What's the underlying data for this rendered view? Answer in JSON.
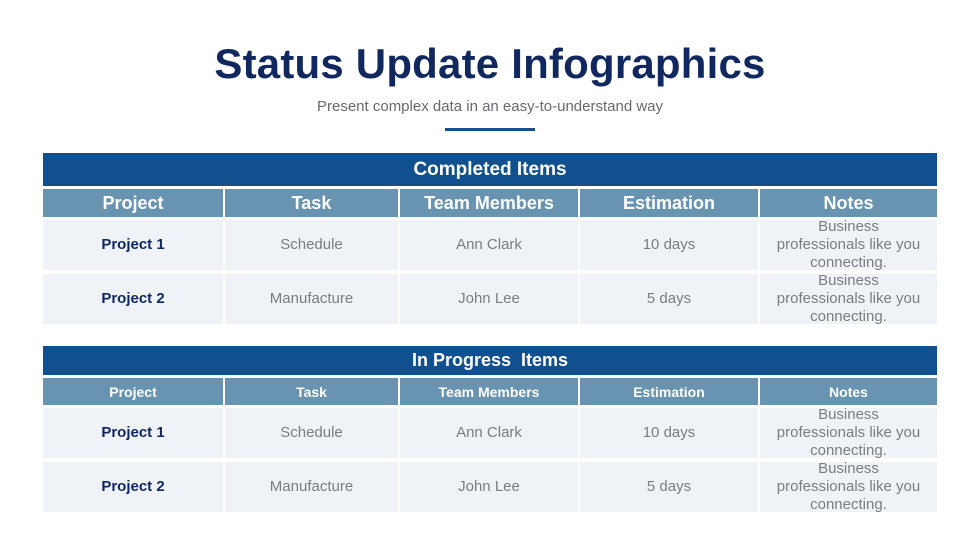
{
  "header": {
    "title": "Status Update Infographics",
    "subtitle": "Present complex data in an easy-to-understand way"
  },
  "colors": {
    "title": "#10275f",
    "table_title_bg": "#10508f",
    "column_header_bg": "#6894b1",
    "row_bg": "#eff2f6",
    "accent_line": "#1b4e8c"
  },
  "tables": [
    {
      "title": "Completed Items",
      "columns": [
        "Project",
        "Task",
        "Team Members",
        "Estimation",
        "Notes"
      ],
      "rows": [
        [
          "Project 1",
          "Schedule",
          "Ann Clark",
          "10 days",
          "Business professionals like you connecting."
        ],
        [
          "Project 2",
          "Manufacture",
          "John Lee",
          "5 days",
          "Business professionals like you connecting."
        ]
      ]
    },
    {
      "title": "In Progress  Items",
      "columns": [
        "Project",
        "Task",
        "Team Members",
        "Estimation",
        "Notes"
      ],
      "rows": [
        [
          "Project 1",
          "Schedule",
          "Ann Clark",
          "10 days",
          "Business professionals like you connecting."
        ],
        [
          "Project 2",
          "Manufacture",
          "John Lee",
          "5 days",
          "Business professionals like you connecting."
        ]
      ]
    }
  ]
}
